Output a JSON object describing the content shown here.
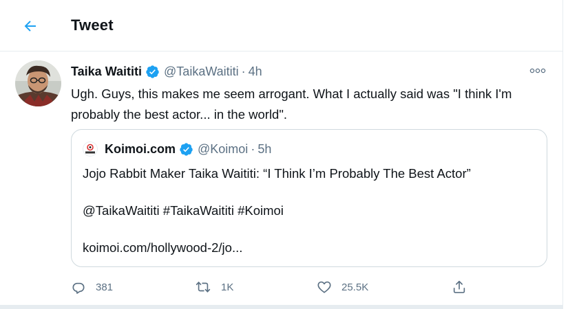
{
  "header": {
    "title": "Tweet"
  },
  "tweet": {
    "author_name": "Taika Waititi",
    "handle": "@TaikaWaititi",
    "separator": "·",
    "time": "4h",
    "text": "Ugh. Guys, this makes me seem arrogant. What I actually said was \"I think I'm probably the best actor... in the world\"."
  },
  "quoted": {
    "name": "Koimoi.com",
    "handle": "@Koimoi",
    "separator": "·",
    "time": "5h",
    "lines": [
      "Jojo Rabbit Maker Taika Waititi: “I Think I’m Probably The Best Actor”",
      "@TaikaWaititi #TaikaWaititi #Koimoi",
      "koimoi.com/hollywood-2/jo..."
    ]
  },
  "actions": {
    "reply_count": "381",
    "retweet_count": "1K",
    "like_count": "25.5K"
  },
  "icons": [
    "back-arrow-icon",
    "verified-badge-icon",
    "more-icon",
    "reply-icon",
    "retweet-icon",
    "like-icon",
    "share-icon"
  ],
  "colors": {
    "accent": "#1da1f2",
    "secondary_text": "#5b7083",
    "border": "#e6ecf0"
  }
}
